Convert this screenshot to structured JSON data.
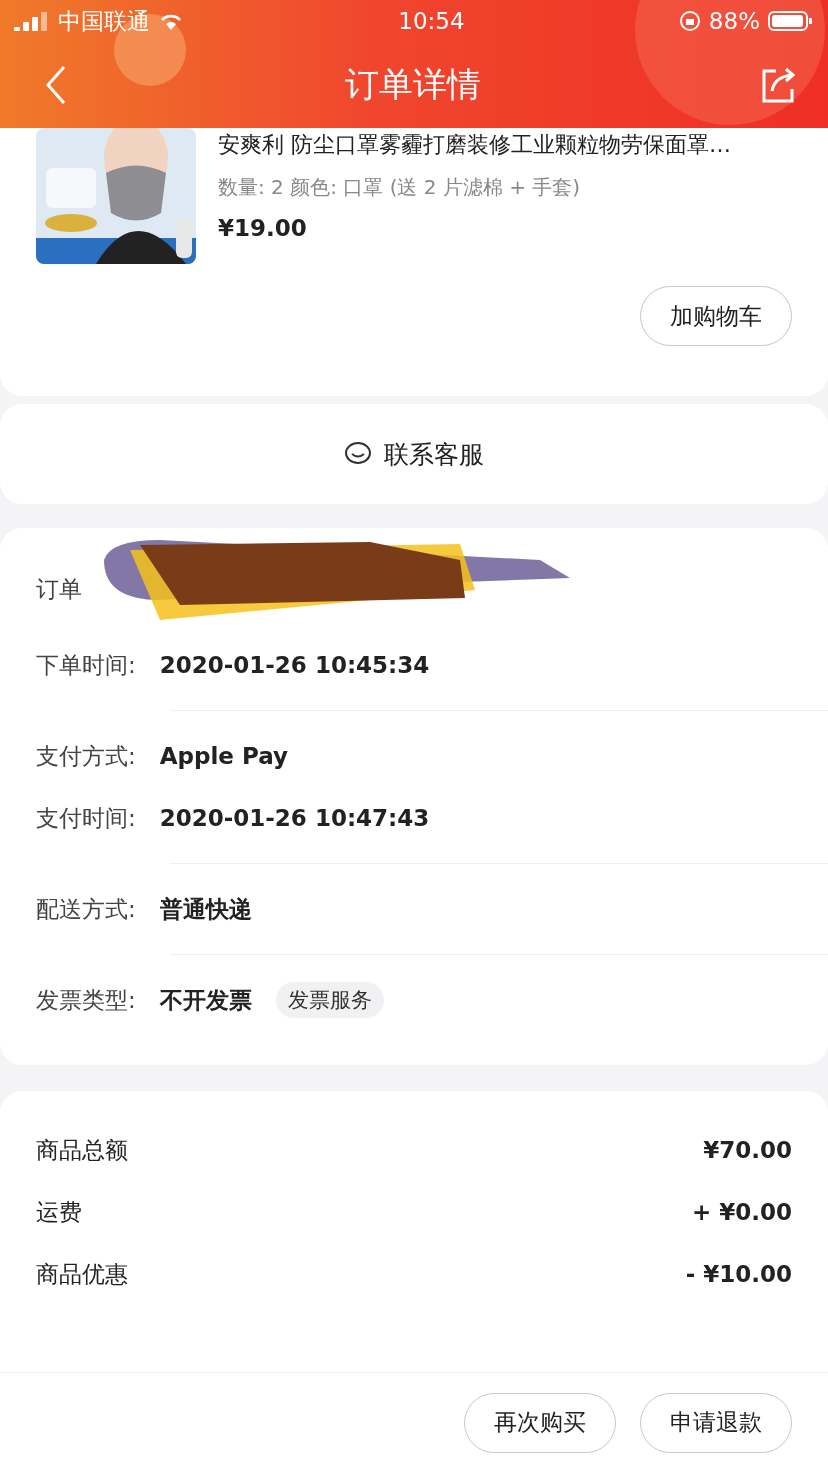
{
  "status_bar": {
    "carrier": "中国联通",
    "time": "10:54",
    "battery": "88%"
  },
  "nav": {
    "title": "订单详情"
  },
  "product": {
    "kind": "picture",
    "title": "安爽利 防尘口罩雾霾打磨装修工业颗粒物劳保面罩…",
    "specs": "数量: 2  颜色: 口罩 (送 2 片滤棉 + 手套)",
    "price": "¥19.00",
    "cart_button": "加购物车"
  },
  "service": {
    "label": "联系客服"
  },
  "order_info": {
    "number_label": "订单",
    "groups": [
      [
        {
          "label": "下单时间:",
          "value": "2020-01-26 10:45:34"
        }
      ],
      [
        {
          "label": "支付方式:",
          "value": "Apple Pay"
        },
        {
          "label": "支付时间:",
          "value": "2020-01-26 10:47:43"
        }
      ],
      [
        {
          "label": "配送方式:",
          "value": "普通快递"
        }
      ],
      [
        {
          "label": "发票类型:",
          "value": "不开发票",
          "tag": "发票服务"
        }
      ]
    ]
  },
  "totals": [
    {
      "label": "商品总额",
      "value": "¥70.00"
    },
    {
      "label": "运费",
      "value": "+ ¥0.00"
    },
    {
      "label": "商品优惠",
      "value": "- ¥10.00"
    }
  ],
  "actions": [
    "再次购买",
    "申请退款"
  ]
}
